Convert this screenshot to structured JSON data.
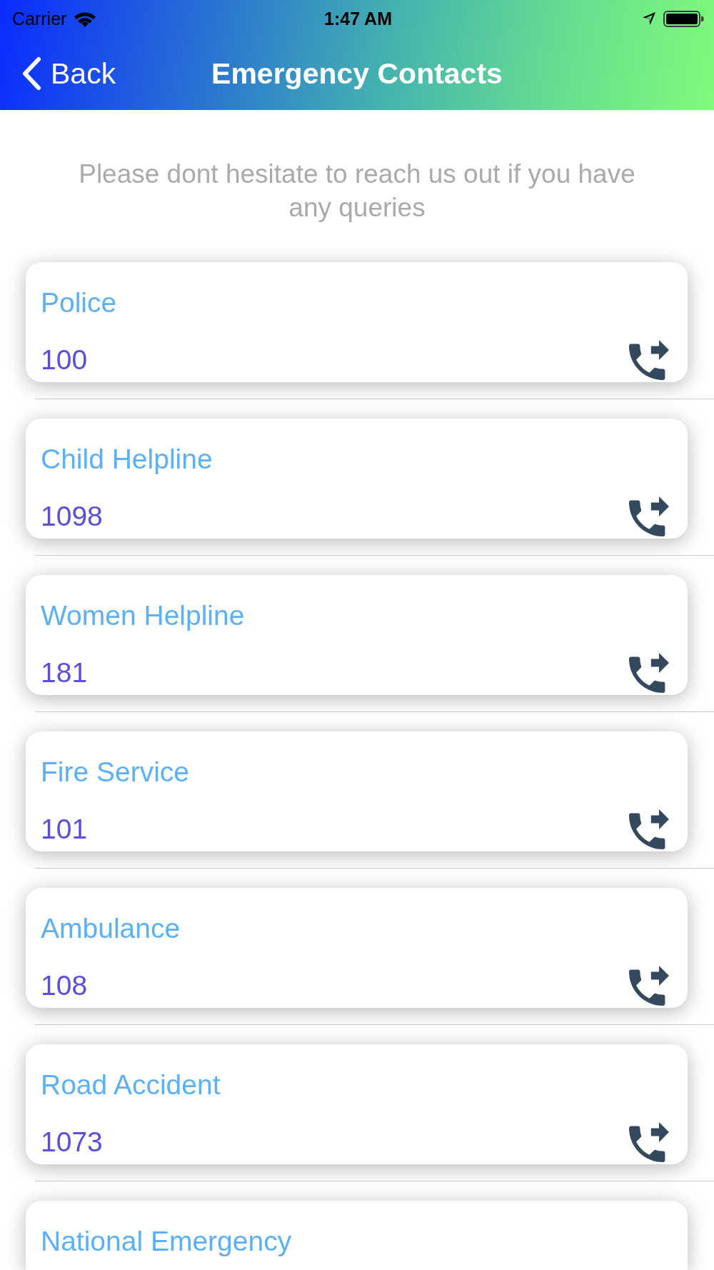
{
  "status_bar": {
    "carrier": "Carrier",
    "time": "1:47 AM"
  },
  "nav_bar": {
    "back": "Back",
    "title": "Emergency Contacts"
  },
  "intro": "Please dont hesitate to reach us out if you have any queries",
  "contacts": [
    {
      "name": "Police",
      "number": "100"
    },
    {
      "name": "Child Helpline",
      "number": "1098"
    },
    {
      "name": "Women Helpline",
      "number": "181"
    },
    {
      "name": "Fire Service",
      "number": "101"
    },
    {
      "name": "Ambulance",
      "number": "108"
    },
    {
      "name": "Road Accident",
      "number": "1073"
    },
    {
      "name": "National Emergency"
    }
  ]
}
